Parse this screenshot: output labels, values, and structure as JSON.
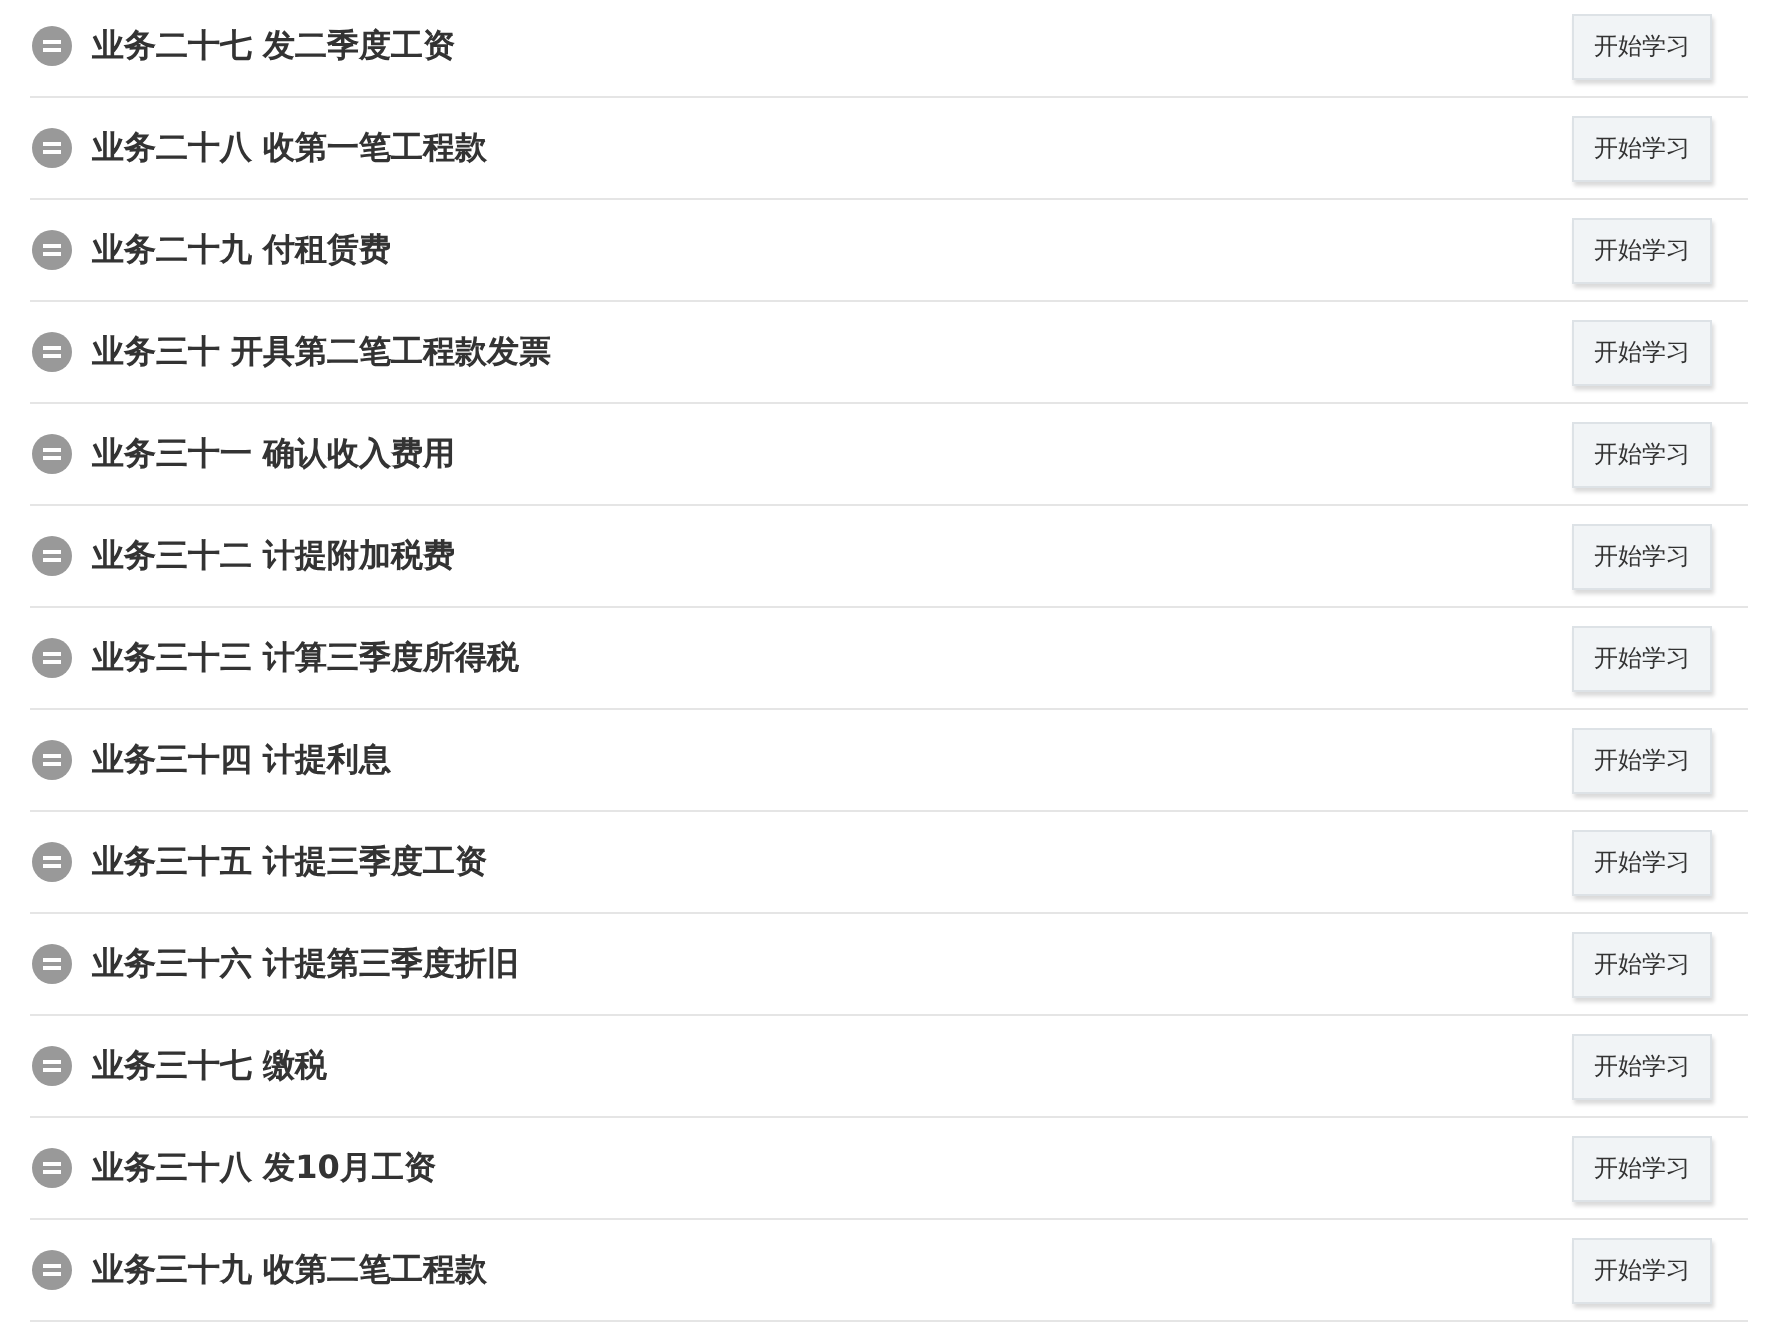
{
  "lessons": [
    {
      "title": "业务二十七 发二季度工资",
      "button": "开始学习"
    },
    {
      "title": "业务二十八 收第一笔工程款",
      "button": "开始学习"
    },
    {
      "title": "业务二十九 付租赁费",
      "button": "开始学习"
    },
    {
      "title": "业务三十 开具第二笔工程款发票",
      "button": "开始学习"
    },
    {
      "title": "业务三十一 确认收入费用",
      "button": "开始学习"
    },
    {
      "title": "业务三十二 计提附加税费",
      "button": "开始学习"
    },
    {
      "title": "业务三十三 计算三季度所得税",
      "button": "开始学习"
    },
    {
      "title": "业务三十四 计提利息",
      "button": "开始学习"
    },
    {
      "title": "业务三十五 计提三季度工资",
      "button": "开始学习"
    },
    {
      "title": "业务三十六 计提第三季度折旧",
      "button": "开始学习"
    },
    {
      "title": "业务三十七 缴税",
      "button": "开始学习"
    },
    {
      "title": "业务三十八 发10月工资",
      "button": "开始学习"
    },
    {
      "title": "业务三十九 收第二笔工程款",
      "button": "开始学习"
    }
  ]
}
